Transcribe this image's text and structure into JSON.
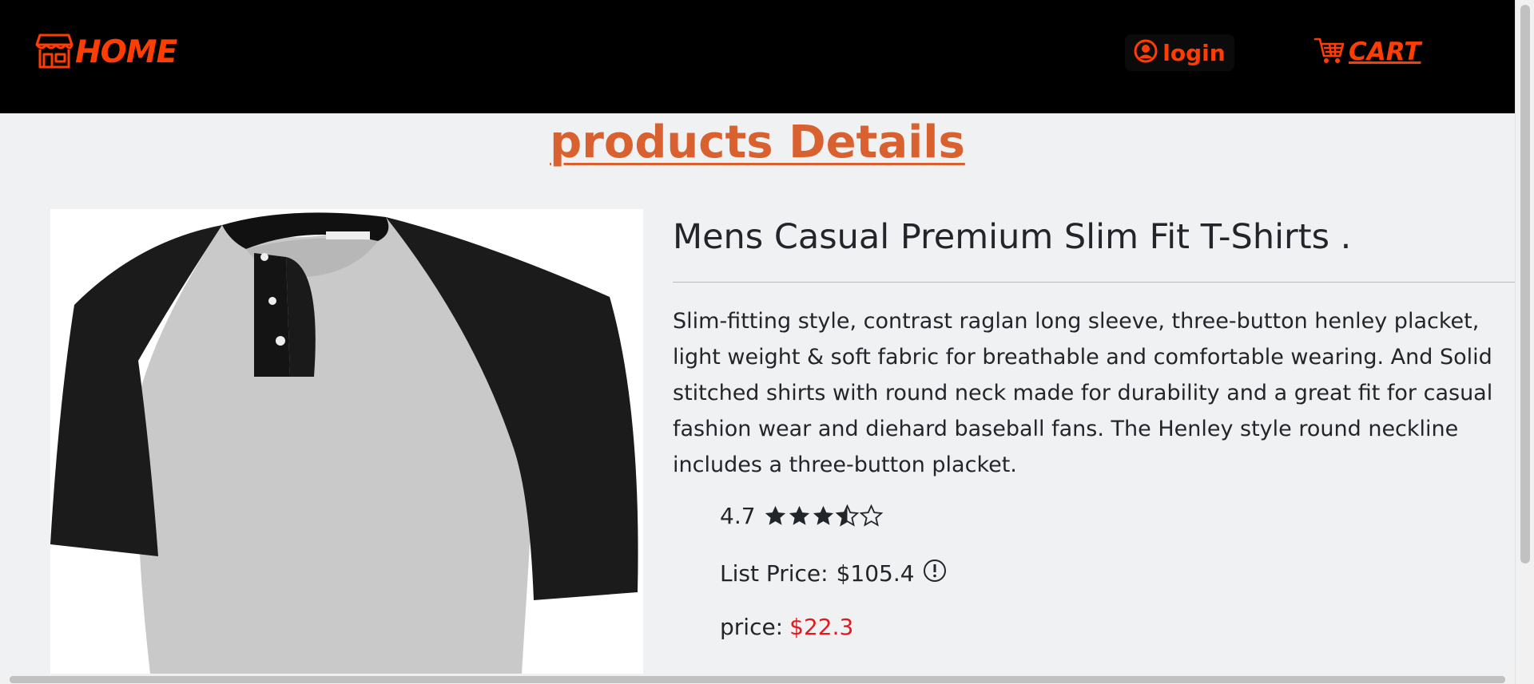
{
  "nav": {
    "home_label": "HOME",
    "login_label": "login",
    "cart_label": "CART",
    "accent_color": "#ff3d00",
    "icons": [
      "store-icon",
      "user-circle-icon",
      "cart-icon"
    ]
  },
  "page": {
    "title": "products Details",
    "title_color": "#d9602f"
  },
  "product": {
    "image_icon": "tshirt-image",
    "name": "Mens Casual Premium Slim Fit T-Shirts .",
    "description": "Slim-fitting style, contrast raglan long sleeve, three-button henley placket, light weight & soft fabric for breathable and comfortable wearing. And Solid stitched shirts with round neck made for durability and a great fit for casual fashion wear and diehard baseball fans. The Henley style round neckline includes a three-button placket.",
    "rating": "4.7",
    "stars": {
      "filled": 3,
      "half": 1,
      "empty": 1
    },
    "list_price_label": "List Price:",
    "list_price": "$105.4",
    "price_label": "price:",
    "price": "$22.3",
    "price_color": "#e3191d"
  }
}
